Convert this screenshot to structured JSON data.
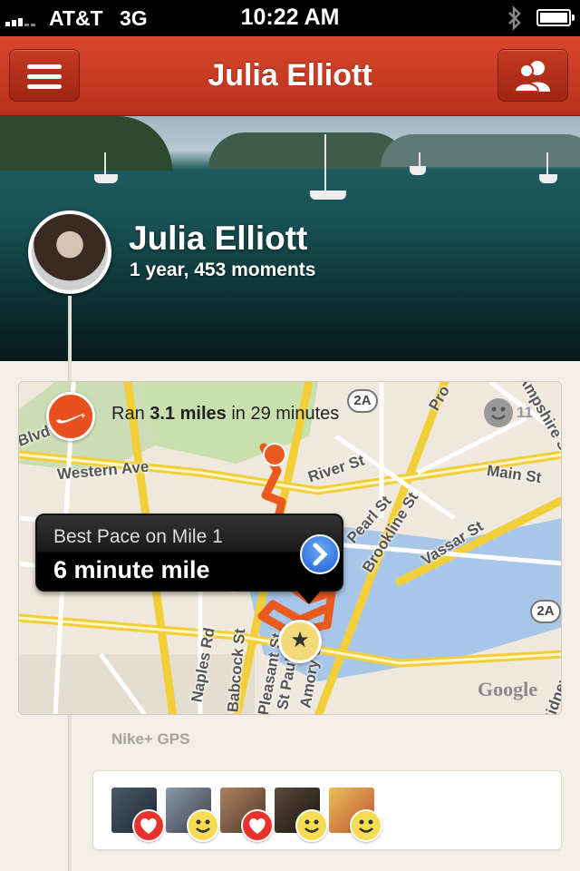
{
  "status_bar": {
    "carrier": "AT&T",
    "network": "3G",
    "time": "10:22 AM",
    "icons": [
      "signal-icon",
      "bluetooth-icon",
      "battery-icon"
    ]
  },
  "navbar": {
    "title": "Julia Elliott",
    "left_icon": "menu-icon",
    "right_icon": "friends-icon",
    "accent_color": "#c4381f"
  },
  "profile": {
    "name": "Julia Elliott",
    "summary": "1 year, 453 moments"
  },
  "moment": {
    "activity_prefix": "Ran ",
    "distance": "3.1 miles",
    "activity_suffix": " in 29 minutes",
    "reaction_count": "11",
    "callout_label": "Best Pace on Mile 1",
    "callout_value": "6 minute mile",
    "streets": [
      "Western Ave",
      "River St",
      "Main St",
      "Pearl St",
      "Brookline St",
      "Vassar St",
      "Naples Rd",
      "Babcock St",
      "Pleasant St",
      "St Paul St",
      "Amory St",
      "Blvd",
      "Pro",
      "Ampshire St",
      "Sidney St"
    ],
    "route_badges": [
      "2A",
      "2A"
    ],
    "map_provider": "Google",
    "source": "Nike+ GPS"
  },
  "reactions": [
    {
      "type": "love"
    },
    {
      "type": "smile"
    },
    {
      "type": "love"
    },
    {
      "type": "smile"
    },
    {
      "type": "smile"
    }
  ]
}
